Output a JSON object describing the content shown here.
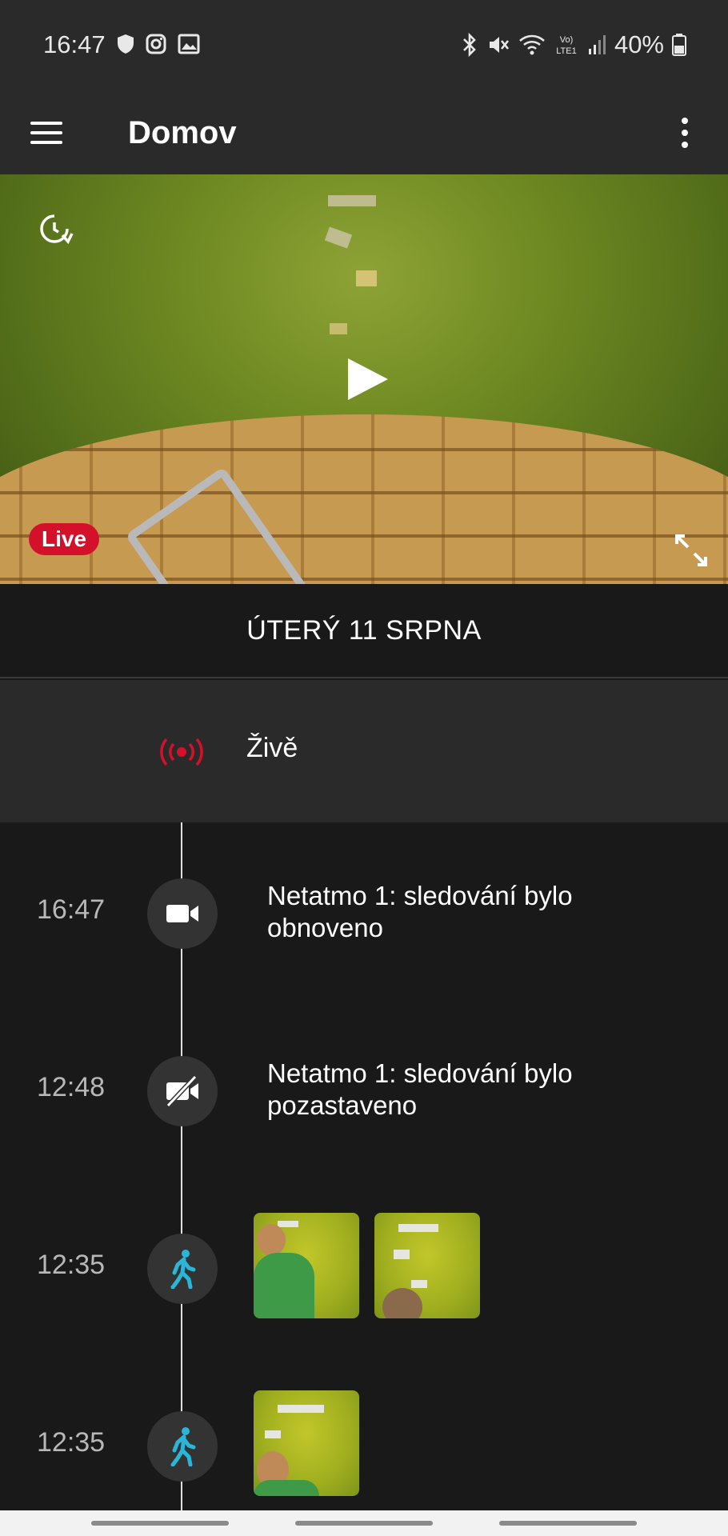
{
  "status_bar": {
    "time": "16:47",
    "battery": "40%",
    "network": "LTE1",
    "icons_left": [
      "shield-icon",
      "instagram-icon",
      "image-icon"
    ],
    "icons_right": [
      "bluetooth-icon",
      "mute-icon",
      "wifi-icon",
      "volte-icon",
      "signal-icon",
      "battery-icon"
    ]
  },
  "app_bar": {
    "title": "Domov"
  },
  "camera": {
    "live_badge": "Live",
    "live_color": "#d4112a"
  },
  "timeline": {
    "date_header": "ÚTERÝ 11 SRPNA",
    "live_label": "Živě",
    "events": [
      {
        "time": "16:47",
        "icon": "video-camera-icon",
        "text": "Netatmo 1: sledování bylo obnoveno"
      },
      {
        "time": "12:48",
        "icon": "video-camera-off-icon",
        "text": "Netatmo 1: sledování bylo pozastaveno"
      },
      {
        "time": "12:35",
        "icon": "person-walking-icon",
        "thumbnails": 2
      },
      {
        "time": "12:35",
        "icon": "person-walking-icon",
        "thumbnails": 1
      }
    ],
    "motion_color": "#2bb6d8"
  }
}
